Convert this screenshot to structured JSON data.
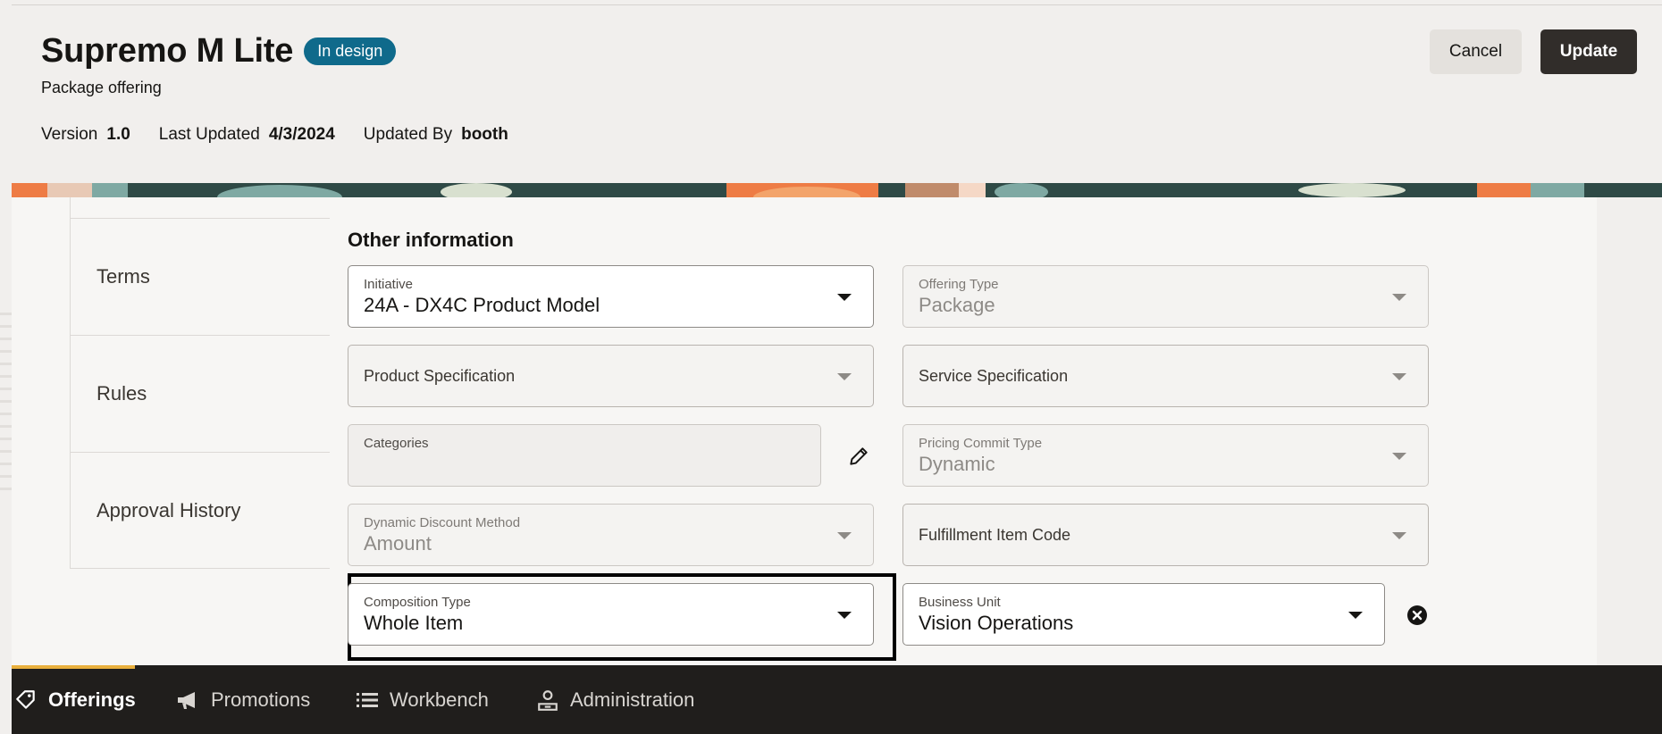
{
  "header": {
    "title": "Supremo M Lite",
    "status": "In design",
    "subtitle": "Package offering",
    "meta": [
      {
        "label": "Version",
        "value": "1.0"
      },
      {
        "label": "Last Updated",
        "value": "4/3/2024"
      },
      {
        "label": "Updated By",
        "value": "booth"
      }
    ],
    "cancel_label": "Cancel",
    "update_label": "Update"
  },
  "side_nav": {
    "items": [
      {
        "label": "Terms"
      },
      {
        "label": "Rules"
      },
      {
        "label": "Approval History"
      }
    ]
  },
  "form": {
    "section_title": "Other information",
    "initiative": {
      "label": "Initiative",
      "value": "24A - DX4C Product Model"
    },
    "offering_type": {
      "label": "Offering Type",
      "value": "Package"
    },
    "product_spec": {
      "label": "Product Specification"
    },
    "service_spec": {
      "label": "Service Specification"
    },
    "categories": {
      "label": "Categories"
    },
    "pricing_commit": {
      "label": "Pricing Commit Type",
      "value": "Dynamic"
    },
    "discount_method": {
      "label": "Dynamic Discount Method",
      "value": "Amount"
    },
    "fulfillment_code": {
      "label": "Fulfillment Item Code"
    },
    "composition_type": {
      "label": "Composition Type",
      "value": "Whole Item"
    },
    "business_unit": {
      "label": "Business Unit",
      "value": "Vision Operations"
    }
  },
  "bottom_nav": {
    "items": [
      {
        "label": "Offerings",
        "icon": "tag-icon"
      },
      {
        "label": "Promotions",
        "icon": "megaphone-icon"
      },
      {
        "label": "Workbench",
        "icon": "list-icon"
      },
      {
        "label": "Administration",
        "icon": "admin-icon"
      }
    ]
  },
  "colors": {
    "status_badge": "#0f6a8b",
    "update_button": "#312d2a",
    "bottom_nav": "#201e1c",
    "active_accent": "#e9b03d"
  }
}
